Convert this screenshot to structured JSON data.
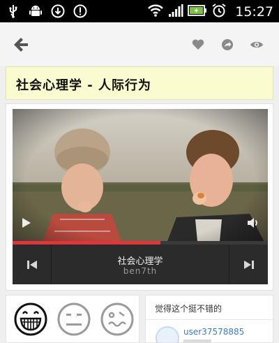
{
  "status_bar": {
    "time": "15:27",
    "icons": [
      "usb-icon",
      "android-debug-icon",
      "download-icon",
      "alert-icon",
      "wifi-icon",
      "signal-icon",
      "battery-charging-icon",
      "alarm-icon"
    ]
  },
  "action_bar": {
    "icons": [
      "back-arrow-icon",
      "heart-icon",
      "share-icon",
      "eye-icon"
    ]
  },
  "title_card": {
    "title": "社会心理学 - 人际行为"
  },
  "player": {
    "track_title": "社会心理学",
    "track_artist": "ben7th",
    "progress": 0.58,
    "accent_color": "#e2353b"
  },
  "rating": {
    "faces": [
      "laughing-face-icon",
      "neutral-face-icon",
      "confused-face-icon"
    ]
  },
  "comments": {
    "header": "觉得这个挺不错的",
    "items": [
      {
        "user": "user37578885"
      }
    ]
  }
}
